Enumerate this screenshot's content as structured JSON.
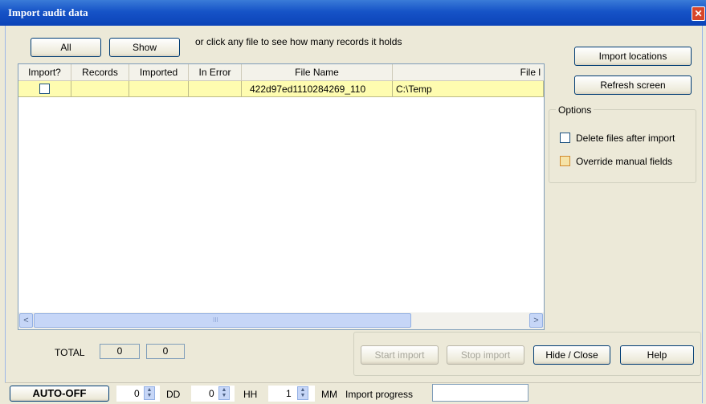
{
  "window": {
    "title": "Import audit data",
    "close_glyph": "✕"
  },
  "toolbar": {
    "all_label": "All",
    "show_label": "Show",
    "hint": "or click any file to see how many records it holds"
  },
  "grid": {
    "columns": [
      "Import?",
      "Records",
      "Imported",
      "In Error",
      "File Name",
      "File l"
    ],
    "rows": [
      {
        "import": false,
        "records": "",
        "imported": "",
        "in_error": "",
        "file_name": "422d97ed1110284269_110",
        "file_location": "C:\\Temp"
      }
    ],
    "scroll_left_glyph": "<",
    "scroll_right_glyph": ">",
    "thumb_grip": "III"
  },
  "side": {
    "import_locations_label": "Import locations",
    "refresh_label": "Refresh screen",
    "options_legend": "Options",
    "delete_files_label": "Delete files after import",
    "override_manual_label": "Override manual fields"
  },
  "totals": {
    "label": "TOTAL",
    "value1": "0",
    "value2": "0"
  },
  "actions": {
    "start_import": "Start import",
    "stop_import": "Stop import",
    "hide_close": "Hide / Close",
    "help": "Help"
  },
  "statusbar": {
    "auto_label": "AUTO-OFF",
    "dd_value": "0",
    "dd_label": "DD",
    "hh_value": "0",
    "hh_label": "HH",
    "mm_value": "1",
    "mm_label": "MM",
    "progress_label": "Import progress",
    "progress_fraction": 0
  }
}
